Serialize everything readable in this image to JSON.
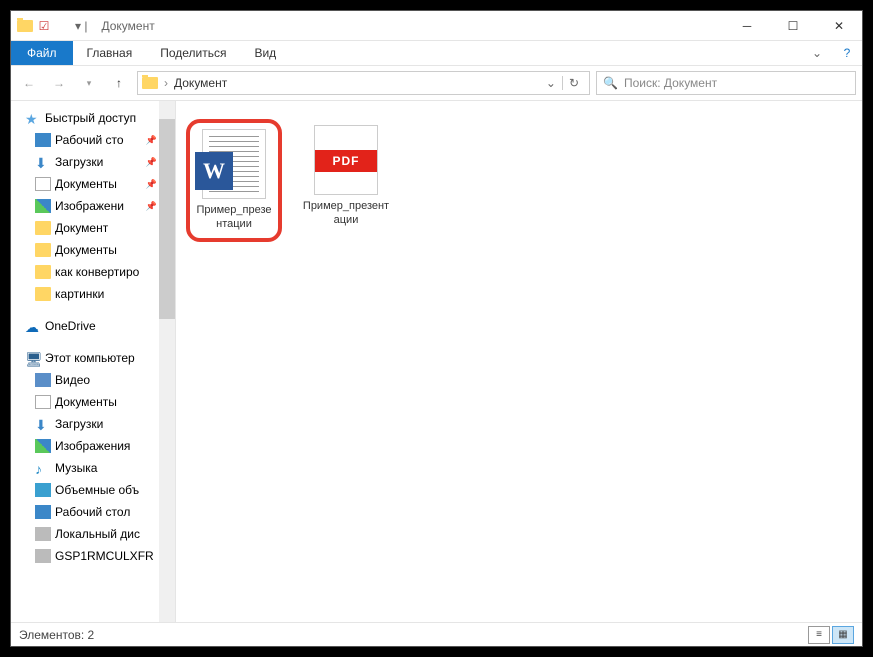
{
  "title": "Документ",
  "ribbon": {
    "file": "Файл",
    "home": "Главная",
    "share": "Поделиться",
    "view": "Вид"
  },
  "address": {
    "current": "Документ"
  },
  "search": {
    "placeholder": "Поиск: Документ"
  },
  "sidebar": {
    "quick_access": "Быстрый доступ",
    "desktop": "Рабочий сто",
    "downloads": "Загрузки",
    "documents": "Документы",
    "pictures": "Изображени",
    "dokument": "Документ",
    "documents2": "Документы",
    "convert": "как конвертиро",
    "kartinki": "картинки",
    "onedrive": "OneDrive",
    "this_pc": "Этот компьютер",
    "video": "Видео",
    "documents3": "Документы",
    "downloads2": "Загрузки",
    "pictures2": "Изображения",
    "music": "Музыка",
    "objects3d": "Объемные объ",
    "desktop2": "Рабочий стол",
    "local_disk": "Локальный дис",
    "gsp": "GSP1RMCULXFR"
  },
  "files": [
    {
      "name": "Пример_презентации",
      "type": "word"
    },
    {
      "name": "Пример_презентации",
      "type": "pdf"
    }
  ],
  "status": {
    "elements": "Элементов: 2"
  }
}
